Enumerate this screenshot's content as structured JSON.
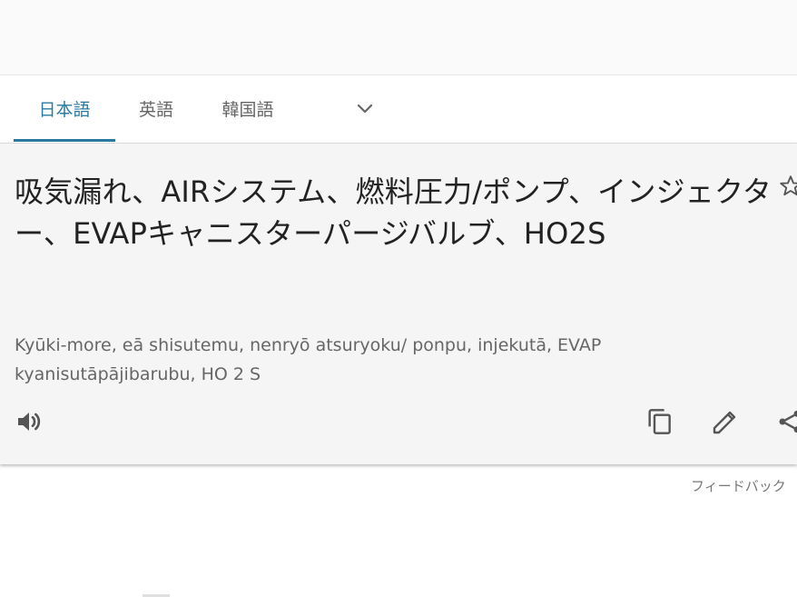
{
  "tabs": [
    {
      "label": "日本語",
      "active": true
    },
    {
      "label": "英語",
      "active": false
    },
    {
      "label": "韓国語",
      "active": false
    }
  ],
  "result": {
    "translation": "吸気漏れ、AIRシステム、燃料圧力/ポンプ、インジェクター、EVAPキャニスターパージバルブ、HO2S",
    "romanization": "Kyūki-more, eā shisutemu, nenryō atsuryoku/ ponpu, injekutā, EVAP kyanisutāpājibarubu, HO 2 S"
  },
  "footer": {
    "feedback_label": "フィードバック"
  },
  "icons": {
    "chevron": "chevron-down-icon",
    "star": "star-icon",
    "speaker": "speaker-icon",
    "copy": "copy-icon",
    "edit": "pencil-icon",
    "share": "share-icon"
  },
  "colors": {
    "accent": "#2a7aa0",
    "card_background": "#f5f5f5",
    "text": "#222222",
    "secondary_text": "#666666"
  }
}
